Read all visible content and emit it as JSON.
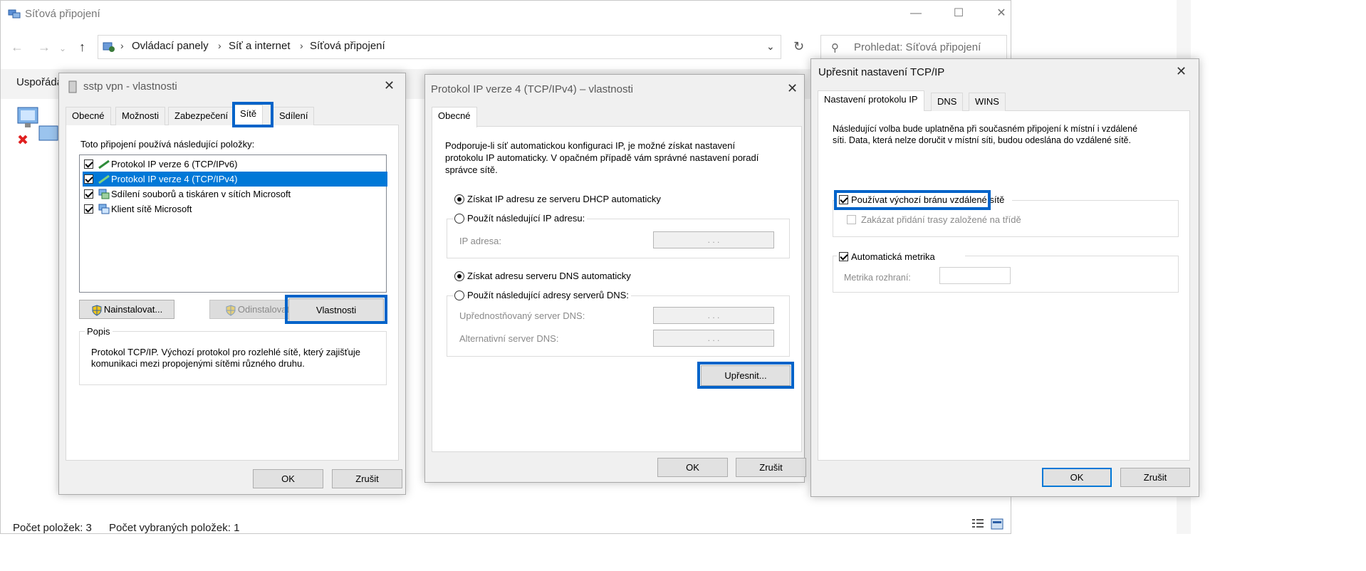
{
  "explorer": {
    "title": "Síťová připojení",
    "breadcrumb": [
      "Ovládací panely",
      "Síť a internet",
      "Síťová připojení"
    ],
    "search_placeholder": "Prohledat: Síťová připojení",
    "ribbon_label": "Uspořádat",
    "status_items": "Počet položek: 3",
    "status_selected": "Počet vybraných položek: 1"
  },
  "sstp": {
    "title": "sstp vpn - vlastnosti",
    "tabs": [
      "Obecné",
      "Možnosti",
      "Zabezpečení",
      "Sítě",
      "Sdílení"
    ],
    "active_tab": "Sítě",
    "list_label": "Toto připojení používá následující položky:",
    "items": [
      {
        "label": "Protokol IP verze 6 (TCP/IPv6)",
        "checked": true,
        "selected": false
      },
      {
        "label": "Protokol IP verze 4 (TCP/IPv4)",
        "checked": true,
        "selected": true
      },
      {
        "label": "Sdílení souborů a tiskáren v sítích Microsoft",
        "checked": true,
        "selected": false
      },
      {
        "label": "Klient sítě Microsoft",
        "checked": true,
        "selected": false
      }
    ],
    "install_btn": "Nainstalovat...",
    "uninstall_btn": "Odinstalovat",
    "properties_btn": "Vlastnosti",
    "description_label": "Popis",
    "description_text": "Protokol TCP/IP. Výchozí protokol pro rozlehlé sítě, který zajišťuje komunikaci mezi propojenými sítěmi různého druhu.",
    "ok": "OK",
    "cancel": "Zrušit"
  },
  "ipv4": {
    "title": "Protokol IP verze 4 (TCP/IPv4) – vlastnosti",
    "tab": "Obecné",
    "intro": "Podporuje-li síť automatickou konfiguraci IP, je možné získat nastavení protokolu IP automaticky. V opačném případě vám správné nastavení poradí správce sítě.",
    "auto_ip": "Získat IP adresu ze serveru DHCP automaticky",
    "manual_ip": "Použít následující IP adresu:",
    "ip_address_label": "IP adresa:",
    "auto_dns": "Získat adresu serveru DNS automaticky",
    "manual_dns": "Použít následující adresy serverů DNS:",
    "preferred_dns_label": "Upřednostňovaný server DNS:",
    "alternate_dns_label": "Alternativní server DNS:",
    "ip_placeholder": ". . .",
    "advanced_btn": "Upřesnit...",
    "ok": "OK",
    "cancel": "Zrušit"
  },
  "advanced": {
    "title": "Upřesnit nastavení TCP/IP",
    "tabs": [
      "Nastavení protokolu IP",
      "DNS",
      "WINS"
    ],
    "active_tab": "Nastavení protokolu IP",
    "info": "Následující volba bude uplatněna při současném připojení k místní i vzdálené síti. Data, která nelze doručit v místní síti, budou odeslána do vzdálené sítě.",
    "use_gateway": "Používat výchozí bránu vzdálené sítě",
    "use_gateway_checked": true,
    "disable_route": "Zakázat přidání trasy založené na třídě",
    "disable_route_checked": false,
    "auto_metric": "Automatická metrika",
    "auto_metric_checked": true,
    "metric_label": "Metrika rozhraní:",
    "metric_value": "",
    "ok": "OK",
    "cancel": "Zrušit"
  },
  "colors": {
    "accent": "#0078d7",
    "highlight_border": "#0063c9"
  }
}
